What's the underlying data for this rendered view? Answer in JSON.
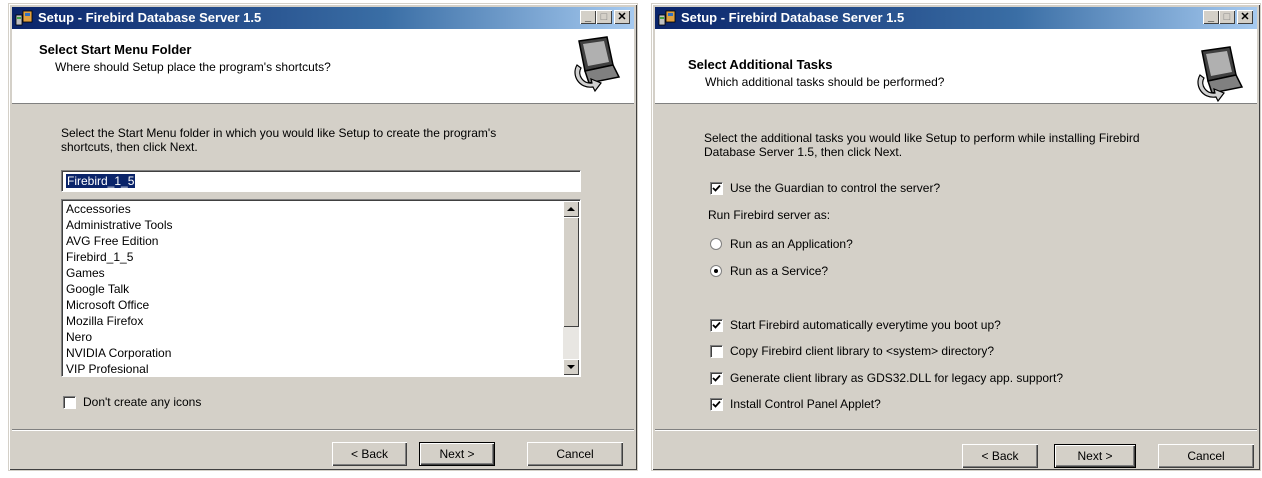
{
  "left_window": {
    "title": "Setup - Firebird Database Server 1.5",
    "header_title": "Select Start Menu Folder",
    "header_subtitle": "Where should Setup place the program's shortcuts?",
    "description_line1": "Select the Start Menu folder in which you would like Setup to create the program's",
    "description_line2": "shortcuts, then click Next.",
    "folder_input_value": "Firebird_1_5",
    "folder_list": [
      "Accessories",
      "Administrative Tools",
      "AVG Free Edition",
      "Firebird_1_5",
      "Games",
      "Google Talk",
      "Microsoft Office",
      "Mozilla Firefox",
      "Nero",
      "NVIDIA Corporation",
      "VIP Profesional"
    ],
    "no_icons_label": "Don't create any icons",
    "no_icons_checked": false,
    "back_label": "< Back",
    "next_label": "Next >",
    "cancel_label": "Cancel"
  },
  "right_window": {
    "title": "Setup - Firebird Database Server 1.5",
    "header_title": "Select Additional Tasks",
    "header_subtitle": "Which additional tasks should be performed?",
    "description_line1": "Select the additional tasks you would like Setup to perform while installing Firebird",
    "description_line2": "Database Server 1.5, then click Next.",
    "guardian_label": "Use the Guardian to control the server?",
    "guardian_checked": true,
    "run_as_label": "Run Firebird server as:",
    "run_app_label": "Run as an Application?",
    "run_app_selected": false,
    "run_service_label": "Run as a Service?",
    "run_service_selected": true,
    "autostart_label": "Start Firebird automatically everytime you boot up?",
    "autostart_checked": true,
    "copy_client_label": "Copy Firebird client library to <system> directory?",
    "copy_client_checked": false,
    "gds32_label": "Generate client library as GDS32.DLL for legacy app. support?",
    "gds32_checked": true,
    "cpl_label": "Install Control Panel Applet?",
    "cpl_checked": true,
    "back_label": "< Back",
    "next_label": "Next >",
    "cancel_label": "Cancel"
  },
  "colors": {
    "title_active": "#0a246a",
    "dialog_face": "#d4d0c8",
    "selection": "#0a246a"
  }
}
